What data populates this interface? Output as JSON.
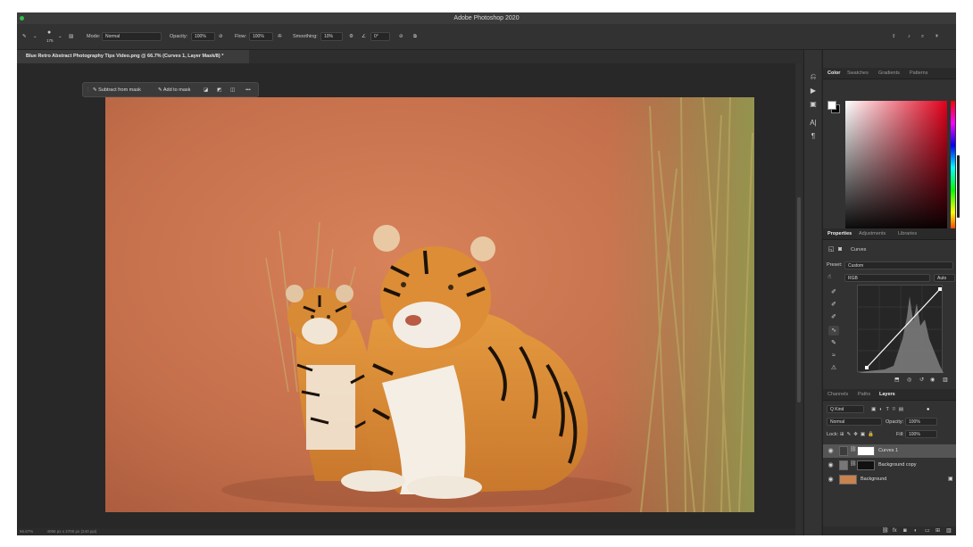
{
  "window": {
    "title": "Adobe Photoshop 2020"
  },
  "options_bar": {
    "brush_size": "175",
    "mode_label": "Mode:",
    "mode_value": "Normal",
    "opacity_label": "Opacity:",
    "opacity_value": "100%",
    "flow_label": "Flow:",
    "flow_value": "100%",
    "smoothing_label": "Smoothing:",
    "smoothing_value": "10%",
    "angle_value": "0°"
  },
  "document": {
    "tab_title": "Blue Retro Abstract Photography Tips Video.png @ 66.7% (Curves 1, Layer Mask/8) *"
  },
  "task_bar": {
    "subtract_label": "Subtract from mask",
    "add_label": "Add to mask"
  },
  "status_bar": {
    "zoom": "66.67%",
    "doc_size": "4096 px x 2700 px (240 ppi)"
  },
  "color_panel": {
    "tabs": [
      "Color",
      "Swatches",
      "Gradients",
      "Patterns"
    ],
    "active_tab": "Color",
    "foreground": "#ffffff",
    "background": "#000000",
    "hue_color": "#e0001b"
  },
  "properties_panel": {
    "tabs": [
      "Properties",
      "Adjustments",
      "Libraries"
    ],
    "active_tab": "Properties",
    "adjustment_name": "Curves",
    "preset_label": "Preset:",
    "preset_value": "Custom",
    "channel_value": "RGB",
    "auto_label": "Auto"
  },
  "layers_panel": {
    "tabs": [
      "Channels",
      "Paths",
      "Layers"
    ],
    "active_tab": "Layers",
    "kind_filter": "Q Kind",
    "blend_mode": "Normal",
    "opacity_label": "Opacity:",
    "opacity_value": "100%",
    "lock_label": "Lock:",
    "fill_label": "Fill:",
    "fill_value": "100%",
    "layers": [
      {
        "name": "Curves 1",
        "selected": true
      },
      {
        "name": "Background copy",
        "selected": false
      },
      {
        "name": "Background",
        "selected": false
      }
    ]
  },
  "icons": [
    "brush-icon",
    "share-icon",
    "bell-icon",
    "search-icon",
    "lightbulb-icon",
    "eye-icon",
    "chain-icon",
    "lock-icon"
  ]
}
